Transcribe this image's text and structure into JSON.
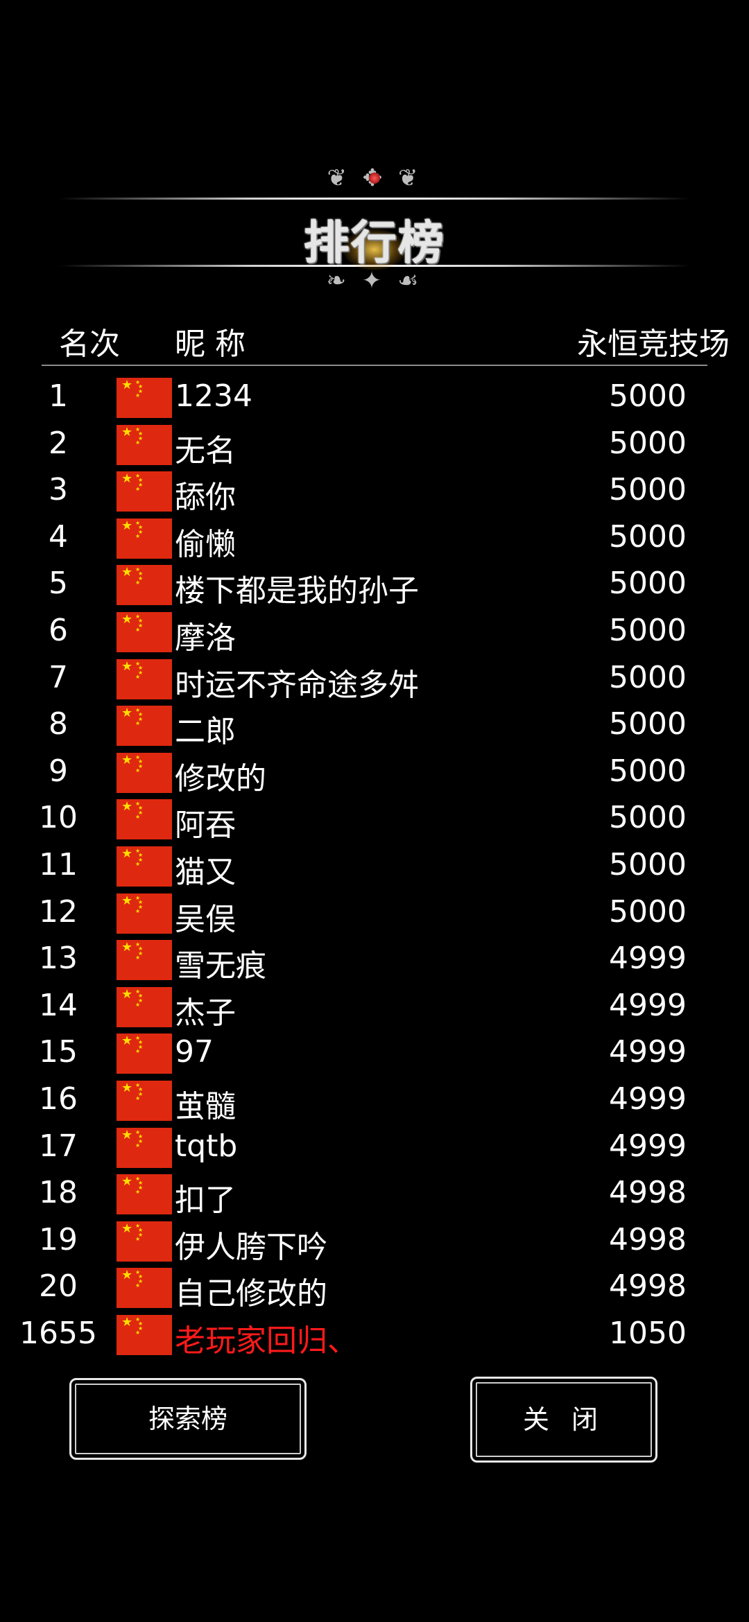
{
  "title": "排行榜",
  "header": {
    "rank": "名次",
    "nickname": "昵 称",
    "score": "永恒竞技场"
  },
  "colors": {
    "flag_red": "#de2910",
    "flag_star": "#ffde00",
    "self_highlight": "#ff1a1a"
  },
  "rows": [
    {
      "rank": "1",
      "flag": "china-flag-icon",
      "nickname": "1234",
      "score": "5000"
    },
    {
      "rank": "2",
      "flag": "china-flag-icon",
      "nickname": "无名",
      "score": "5000"
    },
    {
      "rank": "3",
      "flag": "china-flag-icon",
      "nickname": "舔你",
      "score": "5000"
    },
    {
      "rank": "4",
      "flag": "china-flag-icon",
      "nickname": "偷懒",
      "score": "5000"
    },
    {
      "rank": "5",
      "flag": "china-flag-icon",
      "nickname": "楼下都是我的孙子",
      "score": "5000"
    },
    {
      "rank": "6",
      "flag": "china-flag-icon",
      "nickname": "摩洛",
      "score": "5000"
    },
    {
      "rank": "7",
      "flag": "china-flag-icon",
      "nickname": "时运不齐命途多舛",
      "score": "5000"
    },
    {
      "rank": "8",
      "flag": "china-flag-icon",
      "nickname": "二郎",
      "score": "5000"
    },
    {
      "rank": "9",
      "flag": "china-flag-icon",
      "nickname": "修改的",
      "score": "5000"
    },
    {
      "rank": "10",
      "flag": "china-flag-icon",
      "nickname": "阿吞",
      "score": "5000"
    },
    {
      "rank": "11",
      "flag": "china-flag-icon",
      "nickname": "猫又",
      "score": "5000"
    },
    {
      "rank": "12",
      "flag": "china-flag-icon",
      "nickname": "吴俣",
      "score": "5000"
    },
    {
      "rank": "13",
      "flag": "china-flag-icon",
      "nickname": "雪无痕",
      "score": "4999"
    },
    {
      "rank": "14",
      "flag": "china-flag-icon",
      "nickname": "杰子",
      "score": "4999"
    },
    {
      "rank": "15",
      "flag": "china-flag-icon",
      "nickname": "97",
      "score": "4999"
    },
    {
      "rank": "16",
      "flag": "china-flag-icon",
      "nickname": "茧髓",
      "score": "4999"
    },
    {
      "rank": "17",
      "flag": "china-flag-icon",
      "nickname": "tqtb",
      "score": "4999"
    },
    {
      "rank": "18",
      "flag": "china-flag-icon",
      "nickname": "扣了",
      "score": "4998"
    },
    {
      "rank": "19",
      "flag": "china-flag-icon",
      "nickname": "伊人胯下吟",
      "score": "4998"
    },
    {
      "rank": "20",
      "flag": "china-flag-icon",
      "nickname": "自己修改的",
      "score": "4998"
    }
  ],
  "self_row": {
    "rank": "1655",
    "flag": "china-flag-icon",
    "nickname": "老玩家回归、",
    "score": "1050"
  },
  "buttons": {
    "explore": "探索榜",
    "close": "关 闭"
  }
}
